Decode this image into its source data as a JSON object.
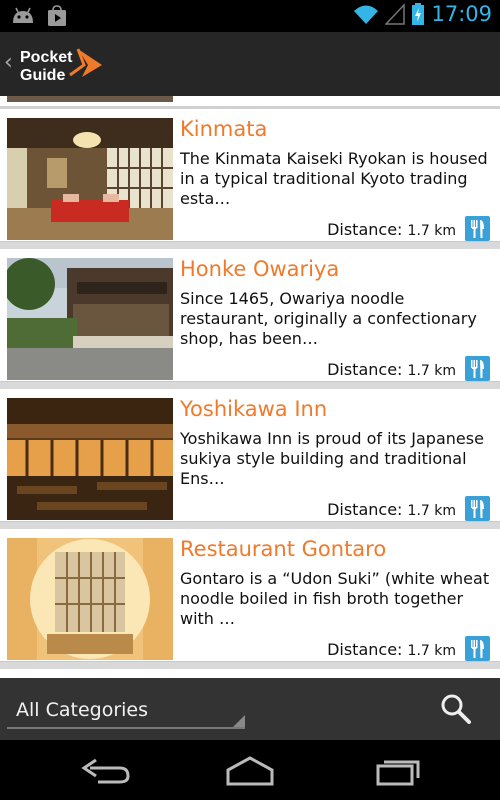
{
  "status_bar": {
    "time": "17:09"
  },
  "header": {
    "logo_text_1": "Pocket",
    "logo_text_2": "Guide"
  },
  "places": [
    {
      "name": "Kinmata",
      "description": "The Kinmata Kaiseki Ryokan is housed in a typical traditional Kyoto trading esta…",
      "distance_label": "Distance:",
      "distance_value": "1.7 km"
    },
    {
      "name": "Honke Owariya",
      "description": "Since 1465, Owariya noodle restaurant, originally a confectionary shop, has been…",
      "distance_label": "Distance:",
      "distance_value": "1.7 km"
    },
    {
      "name": "Yoshikawa Inn",
      "description": "Yoshikawa Inn is proud of its Japanese sukiya style building and traditional Ens…",
      "distance_label": "Distance:",
      "distance_value": "1.7 km"
    },
    {
      "name": "Restaurant Gontaro",
      "description": "Gontaro is a “Udon Suki” (white wheat noodle boiled in fish broth together with …",
      "distance_label": "Distance:",
      "distance_value": "1.7 km"
    }
  ],
  "bottom_bar": {
    "category": "All Categories"
  },
  "colors": {
    "accent": "#f07a2a",
    "icon_blue": "#3aa0d8",
    "status_blue": "#33b5e5",
    "actionbar": "#262626"
  }
}
